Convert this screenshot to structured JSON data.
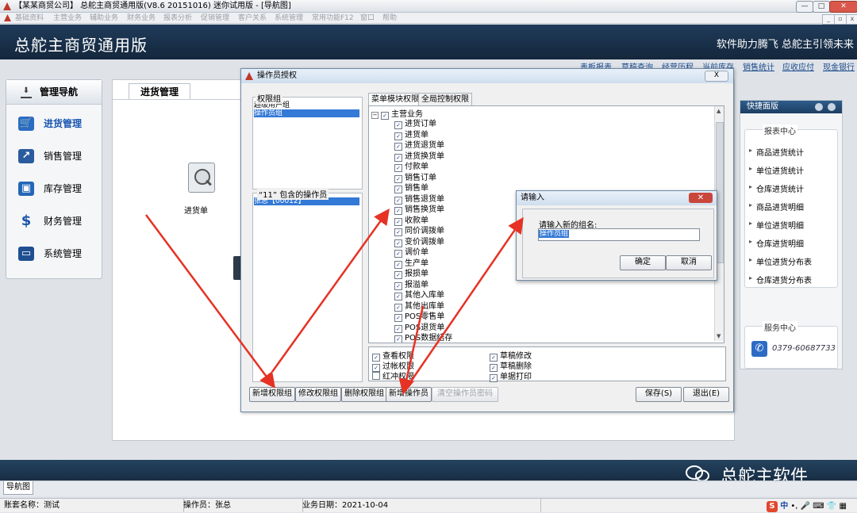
{
  "window": {
    "title": "【某某商贸公司】 总舵主商贸通用版(V8.6 20151016) 迷你试用版 - [导航图]",
    "controls": [
      "—",
      "□",
      "✕"
    ]
  },
  "menubar": [
    "基础资料",
    "主营业务",
    "辅助业务",
    "财务业务",
    "报表分析",
    "促销管理",
    "客户关系",
    "系统管理",
    "常用功能F12",
    "窗口",
    "帮助"
  ],
  "banner": {
    "app_title": "总舵主商贸通用版",
    "slogan": "软件助力腾飞  总舵主引领未来"
  },
  "sublinks": [
    "表板报表",
    "草稿查询",
    "经营历程",
    "当前库存",
    "销售统计",
    "应收应付",
    "现金银行"
  ],
  "nav": {
    "title": "管理导航",
    "items": [
      {
        "label": "进货管理",
        "icon": "cart-icon",
        "active": true
      },
      {
        "label": "销售管理",
        "icon": "chart-icon"
      },
      {
        "label": "库存管理",
        "icon": "box-icon"
      },
      {
        "label": "财务管理",
        "icon": "dollar-icon"
      },
      {
        "label": "系统管理",
        "icon": "monitor-icon"
      }
    ]
  },
  "main": {
    "tab": "进货管理",
    "doc_label": "进货单"
  },
  "quick": {
    "title": "快捷面版",
    "report_title": "报表中心",
    "reports": [
      "商品进货统计",
      "单位进货统计",
      "仓库进货统计",
      "商品进货明细",
      "单位进货明细",
      "仓库进货明细",
      "单位进货分布表",
      "仓库进货分布表"
    ],
    "service_title": "服务中心",
    "phone": "0379-60687733"
  },
  "dialog": {
    "title": "操作员授权",
    "group_label": "权限组",
    "groups": [
      "超级用户组",
      "操作员组"
    ],
    "members_label": "“11” 包含的操作员",
    "members": [
      "张总【00012】"
    ],
    "tabs": [
      "菜单模块权限",
      "全局控制权限"
    ],
    "tree_root": "主营业务",
    "tree_items": [
      "进货订单",
      "进货单",
      "进货退货单",
      "进货换货单",
      "付款单",
      "销售订单",
      "销售单",
      "销售退货单",
      "销售换货单",
      "收款单",
      "同价调拨单",
      "变价调拨单",
      "调价单",
      "生产单",
      "报损单",
      "报溢单",
      "其他入库单",
      "其他出库单",
      "POS零售单",
      "POS退货单",
      "POS数据结存"
    ],
    "perms": [
      {
        "label": "查看权限",
        "checked": true
      },
      {
        "label": "草稿修改",
        "checked": true
      },
      {
        "label": "过帐权限",
        "checked": true
      },
      {
        "label": "草稿删除",
        "checked": true
      },
      {
        "label": "红冲权限",
        "checked": false
      },
      {
        "label": "单据打印",
        "checked": true
      }
    ],
    "buttons": [
      "新增权限组",
      "修改权限组",
      "删除权限组",
      "新增操作员",
      "清空操作员密码"
    ],
    "save": "保存(S)",
    "exit": "退出(E)"
  },
  "input_dialog": {
    "title": "请输入",
    "prompt": "请输入新的组名:",
    "value": "操作员组",
    "ok": "确定",
    "cancel": "取消"
  },
  "watermark": "总舵主软件",
  "bottom_tab": "导航图",
  "status": {
    "account": "账套名称：测试",
    "operator": "操作员：张总",
    "date": "业务日期：2021-10-04"
  },
  "ime": [
    "中",
    "•,",
    "🎤",
    "⌨",
    "👕",
    "▦"
  ]
}
